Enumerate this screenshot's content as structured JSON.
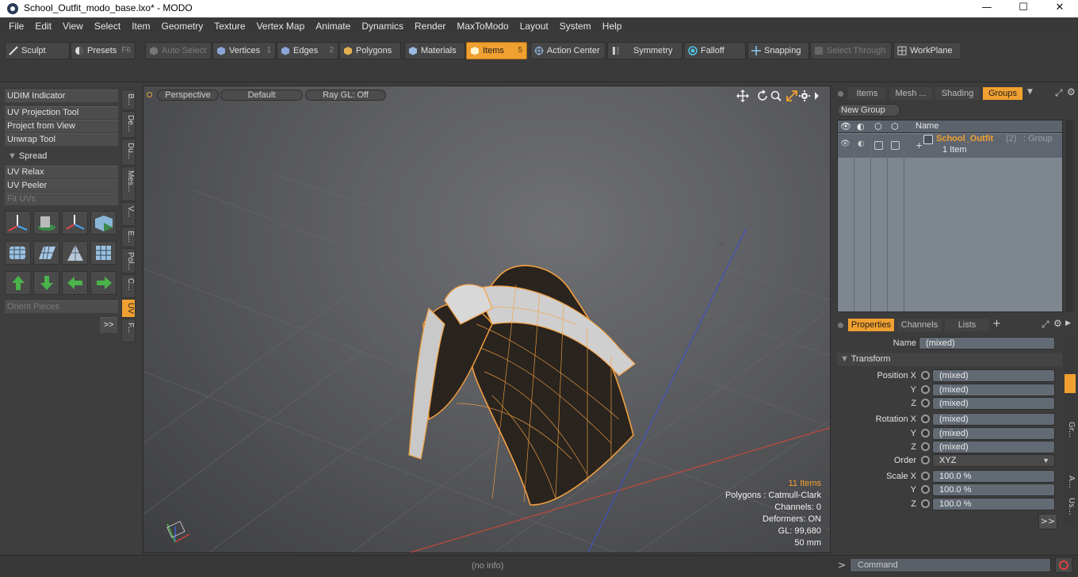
{
  "window": {
    "title": "School_Outfit_modo_base.lxo* - MODO",
    "minimize": "—",
    "maximize": "☐",
    "close": "✕"
  },
  "menu": [
    "File",
    "Edit",
    "View",
    "Select",
    "Item",
    "Geometry",
    "Texture",
    "Vertex Map",
    "Animate",
    "Dynamics",
    "Render",
    "MaxToModo",
    "Layout",
    "System",
    "Help"
  ],
  "toolbar": {
    "sculpt": "Sculpt",
    "presets": "Presets",
    "presets_key": "F6",
    "auto_select": "Auto Select",
    "vertices": "Vertices",
    "vertices_key": "1",
    "edges": "Edges",
    "edges_key": "2",
    "polygons": "Polygons",
    "materials": "Materials",
    "items": "Items",
    "items_key": "5",
    "action_center": "Action Center",
    "symmetry": "Symmetry",
    "falloff": "Falloff",
    "snapping": "Snapping",
    "select_through": "Select Through",
    "workplane": "WorkPlane"
  },
  "left_panel": {
    "udim": "UDIM Indicator",
    "uv_projection": "UV Projection Tool",
    "project_view": "Project from View",
    "unwrap": "Unwrap Tool",
    "spread": "Spread",
    "uv_relax": "UV Relax",
    "uv_peeler": "UV Peeler",
    "fit_uvs": "Fit UVs",
    "orient": "Orient Pieces",
    "more": ">>",
    "vtabs": [
      "B...",
      "De...",
      "Du...",
      "Mes...",
      "V...",
      "E...",
      "Pol...",
      "C...",
      "UV",
      "F..."
    ]
  },
  "viewport": {
    "view": "Perspective",
    "shading": "Default",
    "raygl": "Ray GL: Off",
    "items_count": "11 Items",
    "polygons": "Polygons : Catmull-Clark",
    "channels": "Channels: 0",
    "deformers": "Deformers: ON",
    "gl": "GL: 99,680",
    "focal": "50 mm"
  },
  "items_panel": {
    "tabs": [
      "Items",
      "Mesh ...",
      "Shading",
      "Groups"
    ],
    "new_group": "New Group",
    "name_col": "Name",
    "group_name": "School_Outfit",
    "group_count": "(2)",
    "group_type": ": Group",
    "group_items": "1 Item"
  },
  "properties": {
    "tabs": [
      "Properties",
      "Channels",
      "Lists"
    ],
    "add_tab": "+",
    "name_label": "Name",
    "name_value": "(mixed)",
    "transform": "Transform",
    "position_x": "Position X",
    "rotation_x": "Rotation X",
    "scale_x": "Scale X",
    "y": "Y",
    "z": "Z",
    "order": "Order",
    "order_value": "XYZ",
    "mixed": "(mixed)",
    "scale": "100.0 %",
    "more": ">>",
    "side_tabs": [
      "Gr...",
      "A...",
      "Us..."
    ]
  },
  "status": {
    "info": "(no info)",
    "command_prompt": ">",
    "command": "Command"
  },
  "colors": {
    "accent": "#f0a030",
    "wire": "#f5a040"
  }
}
